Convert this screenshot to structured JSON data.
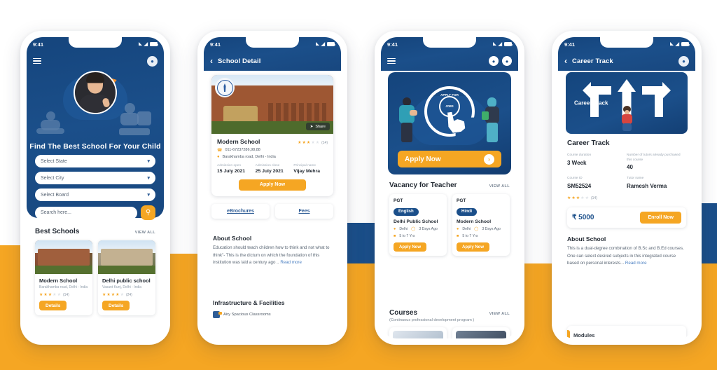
{
  "background": {
    "top_color": "#ffffff",
    "bottom_color": "#f5a623",
    "accent_blue": "#1b4f8a",
    "accent_orange": "#f5a623"
  },
  "phone1": {
    "status": {
      "time": "9:41",
      "signal_icon": "signal-icon",
      "wifi_icon": "wifi-icon",
      "battery_icon": "battery-icon"
    },
    "appbar": {
      "menu_icon": "hamburger-icon",
      "avatar_icon": "user-avatar-icon"
    },
    "hero": {
      "headline": "Find The Best School For Your Child"
    },
    "form": {
      "state_placeholder": "Select State",
      "city_placeholder": "Select City",
      "board_placeholder": "Select Board",
      "search_placeholder": "Search here...",
      "search_icon": "search-icon",
      "chevron_icon": "chevron-down-icon"
    },
    "best_schools": {
      "title": "Best Schools",
      "view_all": "VIEW ALL",
      "cards": [
        {
          "name": "Modern School",
          "address": "Barakhamba road, Delhi - India",
          "rating": 3,
          "rating_count": "(14)",
          "button": "Details"
        },
        {
          "name": "Delhi public school",
          "address": "Vasant Kunj, Delhi - India",
          "rating": 4,
          "rating_count": "(24)",
          "button": "Details"
        }
      ]
    }
  },
  "phone2": {
    "status": {
      "time": "9:41"
    },
    "appbar": {
      "back_icon": "chevron-left-icon",
      "title": "School Detail"
    },
    "detail": {
      "share_label": "Share",
      "share_icon": "share-icon",
      "crest_icon": "school-crest-icon",
      "name": "Modern School",
      "rating": 3,
      "rating_count": "(14)",
      "phone": "011-67237286,98,88",
      "phone_icon": "phone-icon",
      "address": "Barakhamba road, Delhi - India",
      "location_icon": "location-pin-icon",
      "fields": [
        {
          "label": "Admission open",
          "value": "15 July 2021"
        },
        {
          "label": "Admission close",
          "value": "25 July 2021"
        },
        {
          "label": "Principal name",
          "value": "Vijay Mehra"
        }
      ],
      "apply_button": "Apply Now"
    },
    "tabs": [
      {
        "label": "eBrochures"
      },
      {
        "label": "Fees"
      }
    ],
    "about": {
      "title": "About School",
      "text": "Education should teach children how to think and not what to think\"- This is the dictum on which the foundation of this institution was laid a century ago ..",
      "read_more": "Read more"
    },
    "infrastructure": {
      "title": "Infrastructure & Facilities",
      "items": [
        {
          "label": "Airy Spacious Classrooms",
          "icon": "classroom-icon"
        }
      ]
    }
  },
  "phone3": {
    "status": {
      "time": "9:41"
    },
    "appbar": {
      "menu_icon": "hamburger-icon",
      "notification_icon": "notification-bell-icon",
      "avatar_icon": "user-avatar-icon"
    },
    "banner": {
      "ring_text_top": "APPLY FOR",
      "ring_text_inner": "JOBS",
      "cursor_icon": "hand-cursor-icon",
      "apply_button": "Apply Now",
      "arrow_icon": "chevron-right-icon"
    },
    "vacancy": {
      "title": "Vacancy for Teacher",
      "view_all": "VIEW ALL",
      "cards": [
        {
          "level": "PGT",
          "subject": "English",
          "school": "Delhi Public School",
          "location": "Delhi",
          "posted": "3 Days Ago",
          "experience": "5 to 7 Yrs",
          "button": "Apply Now"
        },
        {
          "level": "PGT",
          "subject": "Hindi",
          "school": "Modern School",
          "location": "Delhi",
          "posted": "3 Days Ago",
          "experience": "5 to 7 Yrs",
          "button": "Apply Now"
        }
      ]
    },
    "courses": {
      "title": "Courses",
      "view_all": "VIEW ALL",
      "subtitle": "(Continuous professional development program )"
    }
  },
  "phone4": {
    "status": {
      "time": "9:41"
    },
    "appbar": {
      "back_icon": "chevron-left-icon",
      "title": "Career Track",
      "avatar_icon": "user-avatar-icon"
    },
    "banner": {
      "label": "Career Track",
      "arrows_icon": "career-arrows-icon",
      "kid_icon": "student-icon"
    },
    "course": {
      "title": "Career Track",
      "fields": [
        {
          "label": "Course duration",
          "value": "3 Week"
        },
        {
          "label": "Number of tutors already purchased this course",
          "value": "40"
        },
        {
          "label": "Course ID",
          "value": "SM52524"
        },
        {
          "label": "Tutor name",
          "value": "Ramesh Verma"
        }
      ],
      "rating": 3,
      "rating_count": "(14)",
      "price": "₹ 5000",
      "enroll_button": "Enroll Now"
    },
    "about": {
      "title": "About School",
      "text": "This is a dual-degree combination of B.Sc and B.Ed courses. One can select desired subjects in this integrated course based on personal interests...",
      "read_more": "Read more"
    },
    "modules": {
      "label": "Modules"
    }
  }
}
